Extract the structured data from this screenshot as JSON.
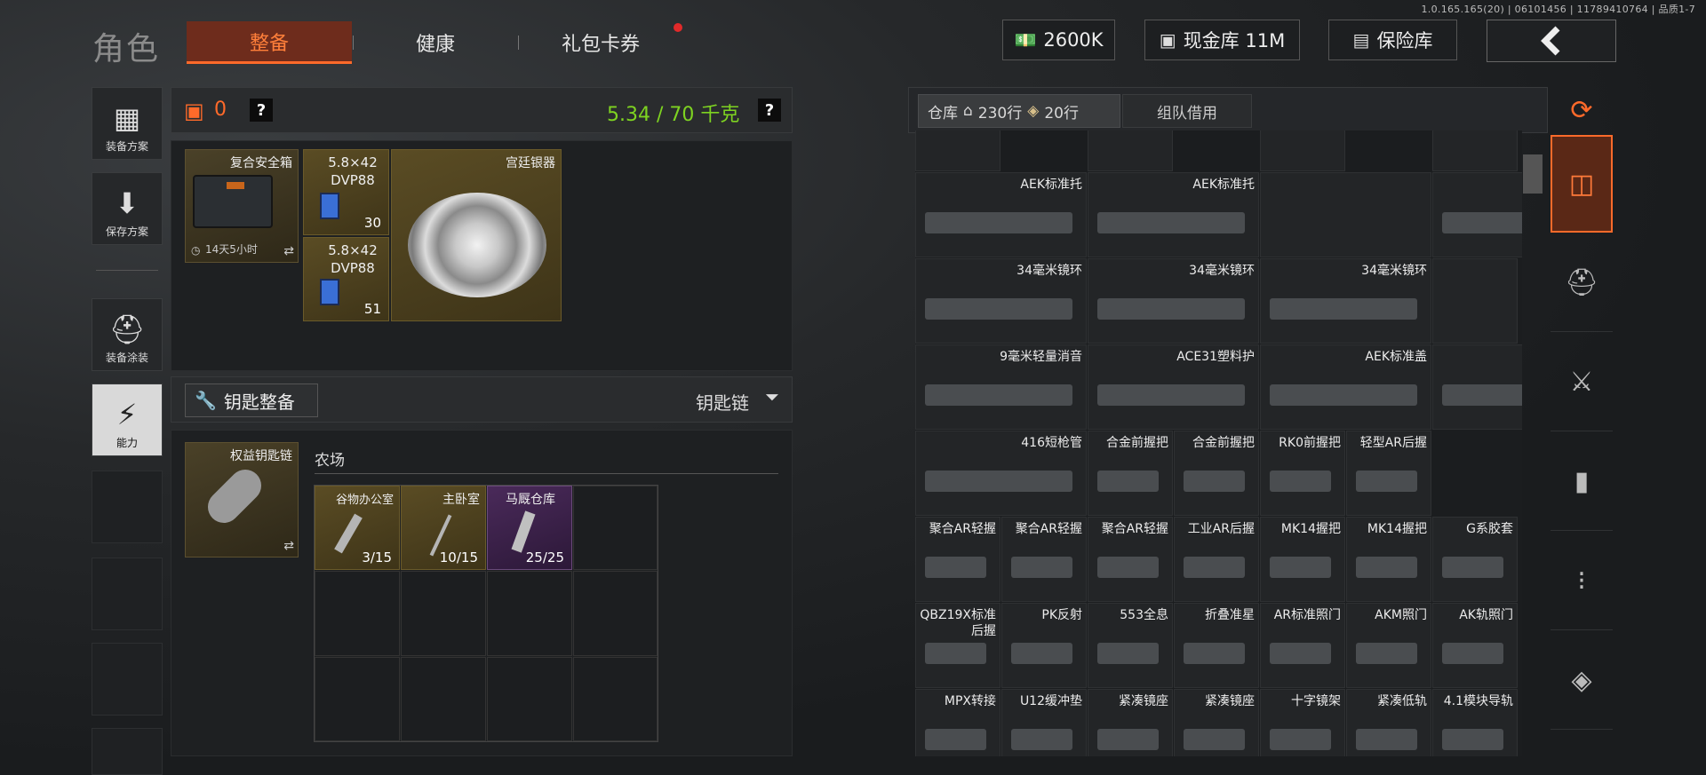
{
  "version": "1.0.165.165(20) | 06101456 | 11789410764 | 品质1-7",
  "title": "角色",
  "tabs": [
    {
      "label": "整备",
      "active": true
    },
    {
      "label": "健康",
      "active": false
    },
    {
      "label": "礼包卡券",
      "active": false,
      "badge": true
    }
  ],
  "currency": {
    "cash_value": "2600K",
    "vault_label": "现金库 11M",
    "safe_label": "保险库"
  },
  "sidebar": {
    "loadout_plan": "装备方案",
    "save_plan": "保存方案",
    "paint": "装备涂装",
    "ability": "能力"
  },
  "equipment": {
    "armor_count": "0",
    "help": "?",
    "weight": "5.34 / 70 千克",
    "safe_box": {
      "name": "复合安全箱",
      "timer": "14天5小时"
    },
    "ammo1": {
      "name": "5.8×42 DVP88",
      "count": "30"
    },
    "ammo2": {
      "name": "5.8×42 DVP88",
      "count": "51"
    },
    "silver": {
      "name": "宫廷银器"
    }
  },
  "keys": {
    "button_label": "钥匙整备",
    "dropdown_label": "钥匙链",
    "keychain_name": "权益钥匙链",
    "section_title": "农场",
    "slots": [
      {
        "name": "谷物办公室",
        "uses": "3/15"
      },
      {
        "name": "主卧室",
        "uses": "10/15"
      },
      {
        "name": "马厩仓库",
        "uses": "25/25"
      }
    ]
  },
  "warehouse": {
    "tab_label": "仓库",
    "rows_home": "230行",
    "rows_tag": "20行",
    "team_borrow": "组队借用",
    "items": [
      [
        "",
        "",
        "",
        ""
      ],
      [
        "AEK标准托",
        "AEK标准托",
        "",
        "34毫米镜环"
      ],
      [
        "34毫米镜环",
        "34毫米镜环",
        "34毫米镜环",
        ""
      ],
      [
        "9毫米轻量消音",
        "ACE31塑料护",
        "AEK标准盖",
        "AEK标准盖"
      ],
      [
        "416短枪管",
        "合金前握把",
        "合金前握把",
        "RK0前握把",
        "轻型AR后握"
      ],
      [
        "聚合AR轻握",
        "聚合AR轻握",
        "聚合AR轻握",
        "工业AR后握",
        "MK14握把",
        "MK14握把",
        "G系胶套"
      ],
      [
        "QBZ19X标准后握",
        "PK反射",
        "553全息",
        "折叠准星",
        "AR标准照门",
        "AKM照门",
        "AK轨照门"
      ],
      [
        "MPX转接",
        "U12缓冲垫",
        "紧凑镜座",
        "紧凑镜座",
        "十字镜架",
        "紧凑低轨",
        "4.1模块导轨"
      ]
    ]
  },
  "colors": {
    "accent": "#ff6a2a",
    "weight_green": "#7ed321",
    "gold_slot": "#5a4c24",
    "purple_slot": "#4a2a5a"
  }
}
